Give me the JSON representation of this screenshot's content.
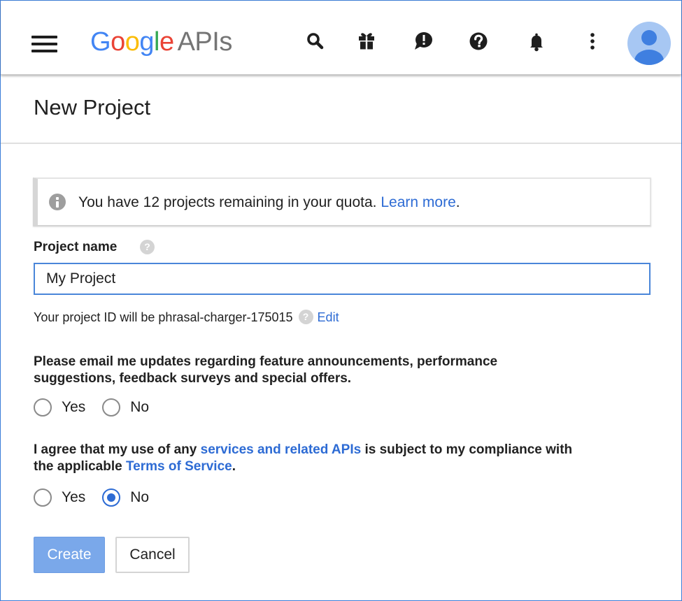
{
  "header": {
    "logo": {
      "g1": "G",
      "o1": "o",
      "o2": "o",
      "g2": "g",
      "l": "l",
      "e": "e",
      "product": "APIs"
    },
    "icons": [
      "menu-icon",
      "search-icon",
      "gift-icon",
      "feedback-icon",
      "help-icon",
      "notifications-icon",
      "more-vert-icon",
      "account-avatar"
    ]
  },
  "page": {
    "title": "New Project"
  },
  "quota_notice": {
    "text": "You have 12 projects remaining in your quota.",
    "link": "Learn more",
    "suffix": "."
  },
  "project_name": {
    "label": "Project name",
    "help": "?",
    "value": "My Project"
  },
  "project_id": {
    "text": "Your project ID will be phrasal-charger-175015",
    "help": "?",
    "edit": "Edit"
  },
  "email_updates": {
    "question": "Please email me updates regarding feature announcements, performance",
    "question_line2": "suggestions, feedback surveys and special offers.",
    "options": [
      {
        "label": "Yes",
        "selected": false
      },
      {
        "label": "No",
        "selected": false
      }
    ]
  },
  "terms": {
    "text_1": "I agree that my use of any ",
    "link_1": "services and related APIs",
    "text_2": " is subject to my compliance with",
    "text_3": "the applicable ",
    "link_2": "Terms of Service",
    "text_4": ".",
    "options": [
      {
        "label": "Yes",
        "selected": false
      },
      {
        "label": "No",
        "selected": true
      }
    ]
  },
  "buttons": {
    "create": "Create",
    "cancel": "Cancel"
  },
  "colors": {
    "accent": "#2d6bd4",
    "create_button": "#7aa8ea",
    "input_border": "#4a86d9"
  }
}
